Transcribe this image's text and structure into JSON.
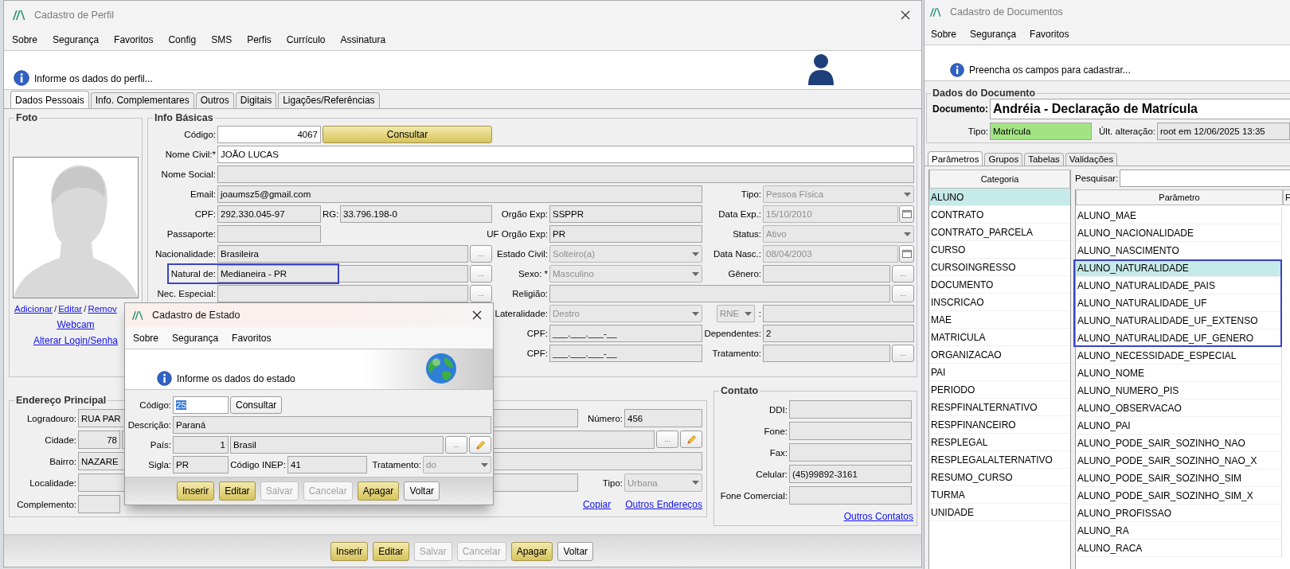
{
  "profile_window": {
    "title": "Cadastro de Perfil",
    "menu": [
      "Sobre",
      "Segurança",
      "Favoritos",
      "Config",
      "SMS",
      "Perfis",
      "Currículo",
      "Assinatura"
    ],
    "info_message": "Informe os dados do perfil...",
    "tabs": [
      {
        "label": "Dados Pessoais",
        "selected": true
      },
      {
        "label": "Info. Complementares",
        "selected": false
      },
      {
        "label": "Outros",
        "selected": false
      },
      {
        "label": "Digitais",
        "selected": false
      },
      {
        "label": "Ligações/Referências",
        "selected": false
      }
    ],
    "photo_group": {
      "title": "Foto",
      "links": [
        {
          "kind": "link",
          "text": "Adicionar"
        },
        {
          "kind": "separator",
          "text": "/"
        },
        {
          "kind": "link",
          "text": "Editar"
        },
        {
          "kind": "separator",
          "text": "/"
        },
        {
          "kind": "link",
          "text": "Remov"
        }
      ],
      "webcam_link": "Webcam",
      "login_link": "Alterar Login/Senha"
    },
    "basic_info": {
      "title": "Info Básicas",
      "items": [
        {
          "kind": "label",
          "text": "Código:"
        },
        {
          "kind": "number",
          "value": "4067",
          "readonly": false
        },
        {
          "kind": "gold_button",
          "label": "Consultar",
          "disabled": false
        },
        {
          "kind": "label",
          "text": "Nome Civil:*"
        },
        {
          "kind": "field",
          "value": "JOÃO LUCAS",
          "readonly": false
        },
        {
          "kind": "label",
          "text": "Nome Social:"
        },
        {
          "kind": "field",
          "readonly": true
        },
        {
          "kind": "label",
          "text": "Email:"
        },
        {
          "kind": "field",
          "value": "joaumsz5@gmail.com",
          "readonly": true
        },
        {
          "kind": "label",
          "text": "Tipo:"
        },
        {
          "kind": "combo",
          "value": "Pessoa Física",
          "disabled": true
        },
        {
          "kind": "label",
          "text": "CPF:"
        },
        {
          "kind": "field",
          "value": "292.330.045-97",
          "readonly": true
        },
        {
          "kind": "label",
          "text": "RG:"
        },
        {
          "kind": "field",
          "value": "33.796.198-0",
          "readonly": true
        },
        {
          "kind": "label",
          "text": "Orgão Exp:"
        },
        {
          "kind": "field",
          "value": "SSPPR",
          "readonly": true
        },
        {
          "kind": "label",
          "text": "Data Exp.:"
        },
        {
          "kind": "date",
          "value": "15/10/2010",
          "disabled": true
        },
        {
          "kind": "label",
          "text": "Passaporte:"
        },
        {
          "kind": "field",
          "readonly": true
        },
        {
          "kind": "label",
          "text": "UF Orgão Exp:"
        },
        {
          "kind": "field",
          "value": "PR",
          "readonly": true
        },
        {
          "kind": "label",
          "text": "Status:"
        },
        {
          "kind": "combo",
          "value": "Ativo",
          "disabled": true
        },
        {
          "kind": "label",
          "text": "Nacionalidade:"
        },
        {
          "kind": "field",
          "value": "Brasileira",
          "readonly": true
        },
        {
          "kind": "ellipsis",
          "label": "..."
        },
        {
          "kind": "label",
          "text": "Estado Civil:"
        },
        {
          "kind": "combo",
          "value": "Solteiro(a)",
          "disabled": true
        },
        {
          "kind": "label",
          "text": "Data Nasc.:"
        },
        {
          "kind": "date",
          "value": "08/04/2003",
          "disabled": true
        },
        {
          "kind": "label",
          "text": "Natural de:",
          "framed": true
        },
        {
          "kind": "field",
          "value": "Medianeira - PR",
          "readonly": true
        },
        {
          "kind": "ellipsis",
          "label": "..."
        },
        {
          "kind": "label",
          "text": "Sexo: *"
        },
        {
          "kind": "combo",
          "value": "Masculino",
          "disabled": true
        },
        {
          "kind": "label",
          "text": "Gênero:"
        },
        {
          "kind": "field",
          "readonly": true
        },
        {
          "kind": "ellipsis",
          "label": "..."
        },
        {
          "kind": "label",
          "text": "Nec. Especial:"
        },
        {
          "kind": "field",
          "readonly": true
        },
        {
          "kind": "ellipsis",
          "label": "..."
        },
        {
          "kind": "label",
          "text": "Religião:"
        },
        {
          "kind": "field",
          "readonly": true
        },
        {
          "kind": "ellipsis",
          "label": "..."
        },
        {
          "kind": "label",
          "text": "Lateralidade:"
        },
        {
          "kind": "combo",
          "value": "Destro",
          "disabled": true
        },
        {
          "kind": "combo",
          "value": "RNE",
          "disabled": true
        },
        {
          "kind": "label",
          "text": ":"
        },
        {
          "kind": "field",
          "readonly": true
        },
        {
          "kind": "label",
          "text": "CPF:"
        },
        {
          "kind": "field",
          "value": "___.___.___-__",
          "readonly": true
        },
        {
          "kind": "label",
          "text": "Dependentes:"
        },
        {
          "kind": "field",
          "value": "2",
          "readonly": true
        },
        {
          "kind": "label",
          "text": "CPF:"
        },
        {
          "kind": "field",
          "value": "___.___.___-__",
          "readonly": true
        },
        {
          "kind": "label",
          "text": "Tratamento:"
        },
        {
          "kind": "field",
          "readonly": true
        },
        {
          "kind": "ellipsis",
          "label": "..."
        }
      ]
    },
    "address": {
      "title": "Endereço Principal",
      "items": [
        {
          "kind": "label",
          "text": "Logradouro:"
        },
        {
          "kind": "field",
          "value": "RUA PAR",
          "readonly": true
        },
        {
          "kind": "label",
          "text": "Número:"
        },
        {
          "kind": "field",
          "value": "456",
          "readonly": true
        },
        {
          "kind": "label",
          "text": "Cidade:"
        },
        {
          "kind": "number",
          "value": "78",
          "readonly": true
        },
        {
          "kind": "field",
          "readonly": true
        },
        {
          "kind": "ellipsis",
          "label": "..."
        },
        {
          "kind": "edit"
        },
        {
          "kind": "label",
          "text": "Bairro:"
        },
        {
          "kind": "field",
          "value": "NAZARE",
          "readonly": true
        },
        {
          "kind": "label",
          "text": "Localidade:"
        },
        {
          "kind": "field",
          "readonly": true
        },
        {
          "kind": "label",
          "text": "Tipo:"
        },
        {
          "kind": "combo",
          "value": "Urbana",
          "disabled": true
        },
        {
          "kind": "label",
          "text": "Complemento:"
        },
        {
          "kind": "field",
          "readonly": true
        }
      ],
      "links": [
        "Copiar",
        "Outros Endereços"
      ]
    },
    "contact": {
      "title": "Contato",
      "items": [
        {
          "kind": "label",
          "text": "DDI:"
        },
        {
          "kind": "field",
          "readonly": true
        },
        {
          "kind": "label",
          "text": "Fone:"
        },
        {
          "kind": "field",
          "readonly": true
        },
        {
          "kind": "label",
          "text": "Fax:"
        },
        {
          "kind": "field",
          "readonly": true
        },
        {
          "kind": "label",
          "text": "Celular:"
        },
        {
          "kind": "field",
          "value": "(45)99892-3161",
          "readonly": true
        },
        {
          "kind": "label",
          "text": "Fone Comercial:"
        },
        {
          "kind": "field",
          "readonly": true
        }
      ],
      "link": "Outros Contatos"
    },
    "buttons": [
      {
        "label": "Inserir",
        "kind": "gold",
        "disabled": false
      },
      {
        "label": "Editar",
        "kind": "gold",
        "disabled": false
      },
      {
        "label": "Salvar",
        "kind": "plain",
        "disabled": true
      },
      {
        "label": "Cancelar",
        "kind": "plain",
        "disabled": true
      },
      {
        "label": "Apagar",
        "kind": "gold",
        "disabled": false
      },
      {
        "label": "Voltar",
        "kind": "plain",
        "disabled": false
      }
    ]
  },
  "state_dialog": {
    "title": "Cadastro de Estado",
    "menu": [
      "Sobre",
      "Segurança",
      "Favoritos"
    ],
    "info_message": "Informe os dados do estado",
    "items": [
      {
        "kind": "label",
        "text": "Código:"
      },
      {
        "kind": "field",
        "value": "25",
        "readonly": false,
        "text_selected": true
      },
      {
        "kind": "button",
        "label": "Consultar",
        "disabled": false
      },
      {
        "kind": "label",
        "text": "Descrição:"
      },
      {
        "kind": "field",
        "value": "Paraná",
        "readonly": true
      },
      {
        "kind": "label",
        "text": "País:"
      },
      {
        "kind": "number",
        "value": "1",
        "readonly": true
      },
      {
        "kind": "field",
        "value": "Brasil",
        "readonly": true
      },
      {
        "kind": "ellipsis",
        "label": "..."
      },
      {
        "kind": "edit"
      },
      {
        "kind": "label",
        "text": "Sigla:"
      },
      {
        "kind": "field",
        "value": "PR",
        "readonly": true
      },
      {
        "kind": "label",
        "text": "Código INEP:"
      },
      {
        "kind": "field",
        "value": "41",
        "readonly": true
      },
      {
        "kind": "label",
        "text": "Tratamento:"
      },
      {
        "kind": "combo",
        "value": "do",
        "disabled": true
      }
    ],
    "buttons": [
      {
        "label": "Inserir",
        "kind": "gold",
        "disabled": false
      },
      {
        "label": "Editar",
        "kind": "gold",
        "disabled": false
      },
      {
        "label": "Salvar",
        "kind": "plain",
        "disabled": true
      },
      {
        "label": "Cancelar",
        "kind": "plain",
        "disabled": true
      },
      {
        "label": "Apagar",
        "kind": "gold",
        "disabled": false
      },
      {
        "label": "Voltar",
        "kind": "plain",
        "disabled": false
      }
    ]
  },
  "documents_window": {
    "title": "Cadastro de Documentos",
    "menu": [
      "Sobre",
      "Segurança",
      "Favoritos"
    ],
    "info_message": "Preencha os campos para cadastrar...",
    "group_title": "Dados do Documento",
    "document_label": "Documento:",
    "document_value": "Andréia - Declaração de Matrícula",
    "type_label": "Tipo:",
    "type_value": "Matrícula",
    "changed_label": "Últ. alteração:",
    "changed_value": "root em 12/06/2025 13:35",
    "tabs": [
      {
        "label": "Parâmetros",
        "selected": true
      },
      {
        "label": "Grupos",
        "selected": false
      },
      {
        "label": "Tabelas",
        "selected": false
      },
      {
        "label": "Validações",
        "selected": false
      }
    ],
    "category_header": "Categoria",
    "categories": [
      {
        "name": "ALUNO",
        "selected": true
      },
      {
        "name": "CONTRATO",
        "selected": false
      },
      {
        "name": "CONTRATO_PARCELA",
        "selected": false
      },
      {
        "name": "CURSO",
        "selected": false
      },
      {
        "name": "CURSOINGRESSO",
        "selected": false
      },
      {
        "name": "DOCUMENTO",
        "selected": false
      },
      {
        "name": "INSCRICAO",
        "selected": false
      },
      {
        "name": "MAE",
        "selected": false
      },
      {
        "name": "MATRICULA",
        "selected": false
      },
      {
        "name": "ORGANIZACAO",
        "selected": false
      },
      {
        "name": "PAI",
        "selected": false
      },
      {
        "name": "PERIODO",
        "selected": false
      },
      {
        "name": "RESPFINALTERNATIVO",
        "selected": false
      },
      {
        "name": "RESPFINANCEIRO",
        "selected": false
      },
      {
        "name": "RESPLEGAL",
        "selected": false
      },
      {
        "name": "RESPLEGALALTERNATIVO",
        "selected": false
      },
      {
        "name": "RESUMO_CURSO",
        "selected": false
      },
      {
        "name": "TURMA",
        "selected": false
      },
      {
        "name": "UNIDADE",
        "selected": false
      }
    ],
    "search_label": "Pesquisar:",
    "parameter_columns": [
      "Parâmetro",
      "F"
    ],
    "parameters": [
      {
        "name": "ALUNO_MAE",
        "selected": false,
        "framed": false
      },
      {
        "name": "ALUNO_NACIONALIDADE",
        "selected": false,
        "framed": false
      },
      {
        "name": "ALUNO_NASCIMENTO",
        "selected": false,
        "framed": false
      },
      {
        "name": "ALUNO_NATURALIDADE",
        "selected": true,
        "framed": true
      },
      {
        "name": "ALUNO_NATURALIDADE_PAIS",
        "selected": false,
        "framed": true
      },
      {
        "name": "ALUNO_NATURALIDADE_UF",
        "selected": false,
        "framed": true
      },
      {
        "name": "ALUNO_NATURALIDADE_UF_EXTENSO",
        "selected": false,
        "framed": true
      },
      {
        "name": "ALUNO_NATURALIDADE_UF_GENERO",
        "selected": false,
        "framed": true
      },
      {
        "name": "ALUNO_NECESSIDADE_ESPECIAL",
        "selected": false,
        "framed": false
      },
      {
        "name": "ALUNO_NOME",
        "selected": false,
        "framed": false
      },
      {
        "name": "ALUNO_NUMERO_PIS",
        "selected": false,
        "framed": false
      },
      {
        "name": "ALUNO_OBSERVACAO",
        "selected": false,
        "framed": false
      },
      {
        "name": "ALUNO_PAI",
        "selected": false,
        "framed": false
      },
      {
        "name": "ALUNO_PODE_SAIR_SOZINHO_NAO",
        "selected": false,
        "framed": false
      },
      {
        "name": "ALUNO_PODE_SAIR_SOZINHO_NAO_X",
        "selected": false,
        "framed": false
      },
      {
        "name": "ALUNO_PODE_SAIR_SOZINHO_SIM",
        "selected": false,
        "framed": false
      },
      {
        "name": "ALUNO_PODE_SAIR_SOZINHO_SIM_X",
        "selected": false,
        "framed": false
      },
      {
        "name": "ALUNO_PROFISSAO",
        "selected": false,
        "framed": false
      },
      {
        "name": "ALUNO_RA",
        "selected": false,
        "framed": false
      },
      {
        "name": "ALUNO_RACA",
        "selected": false,
        "framed": false
      }
    ]
  }
}
